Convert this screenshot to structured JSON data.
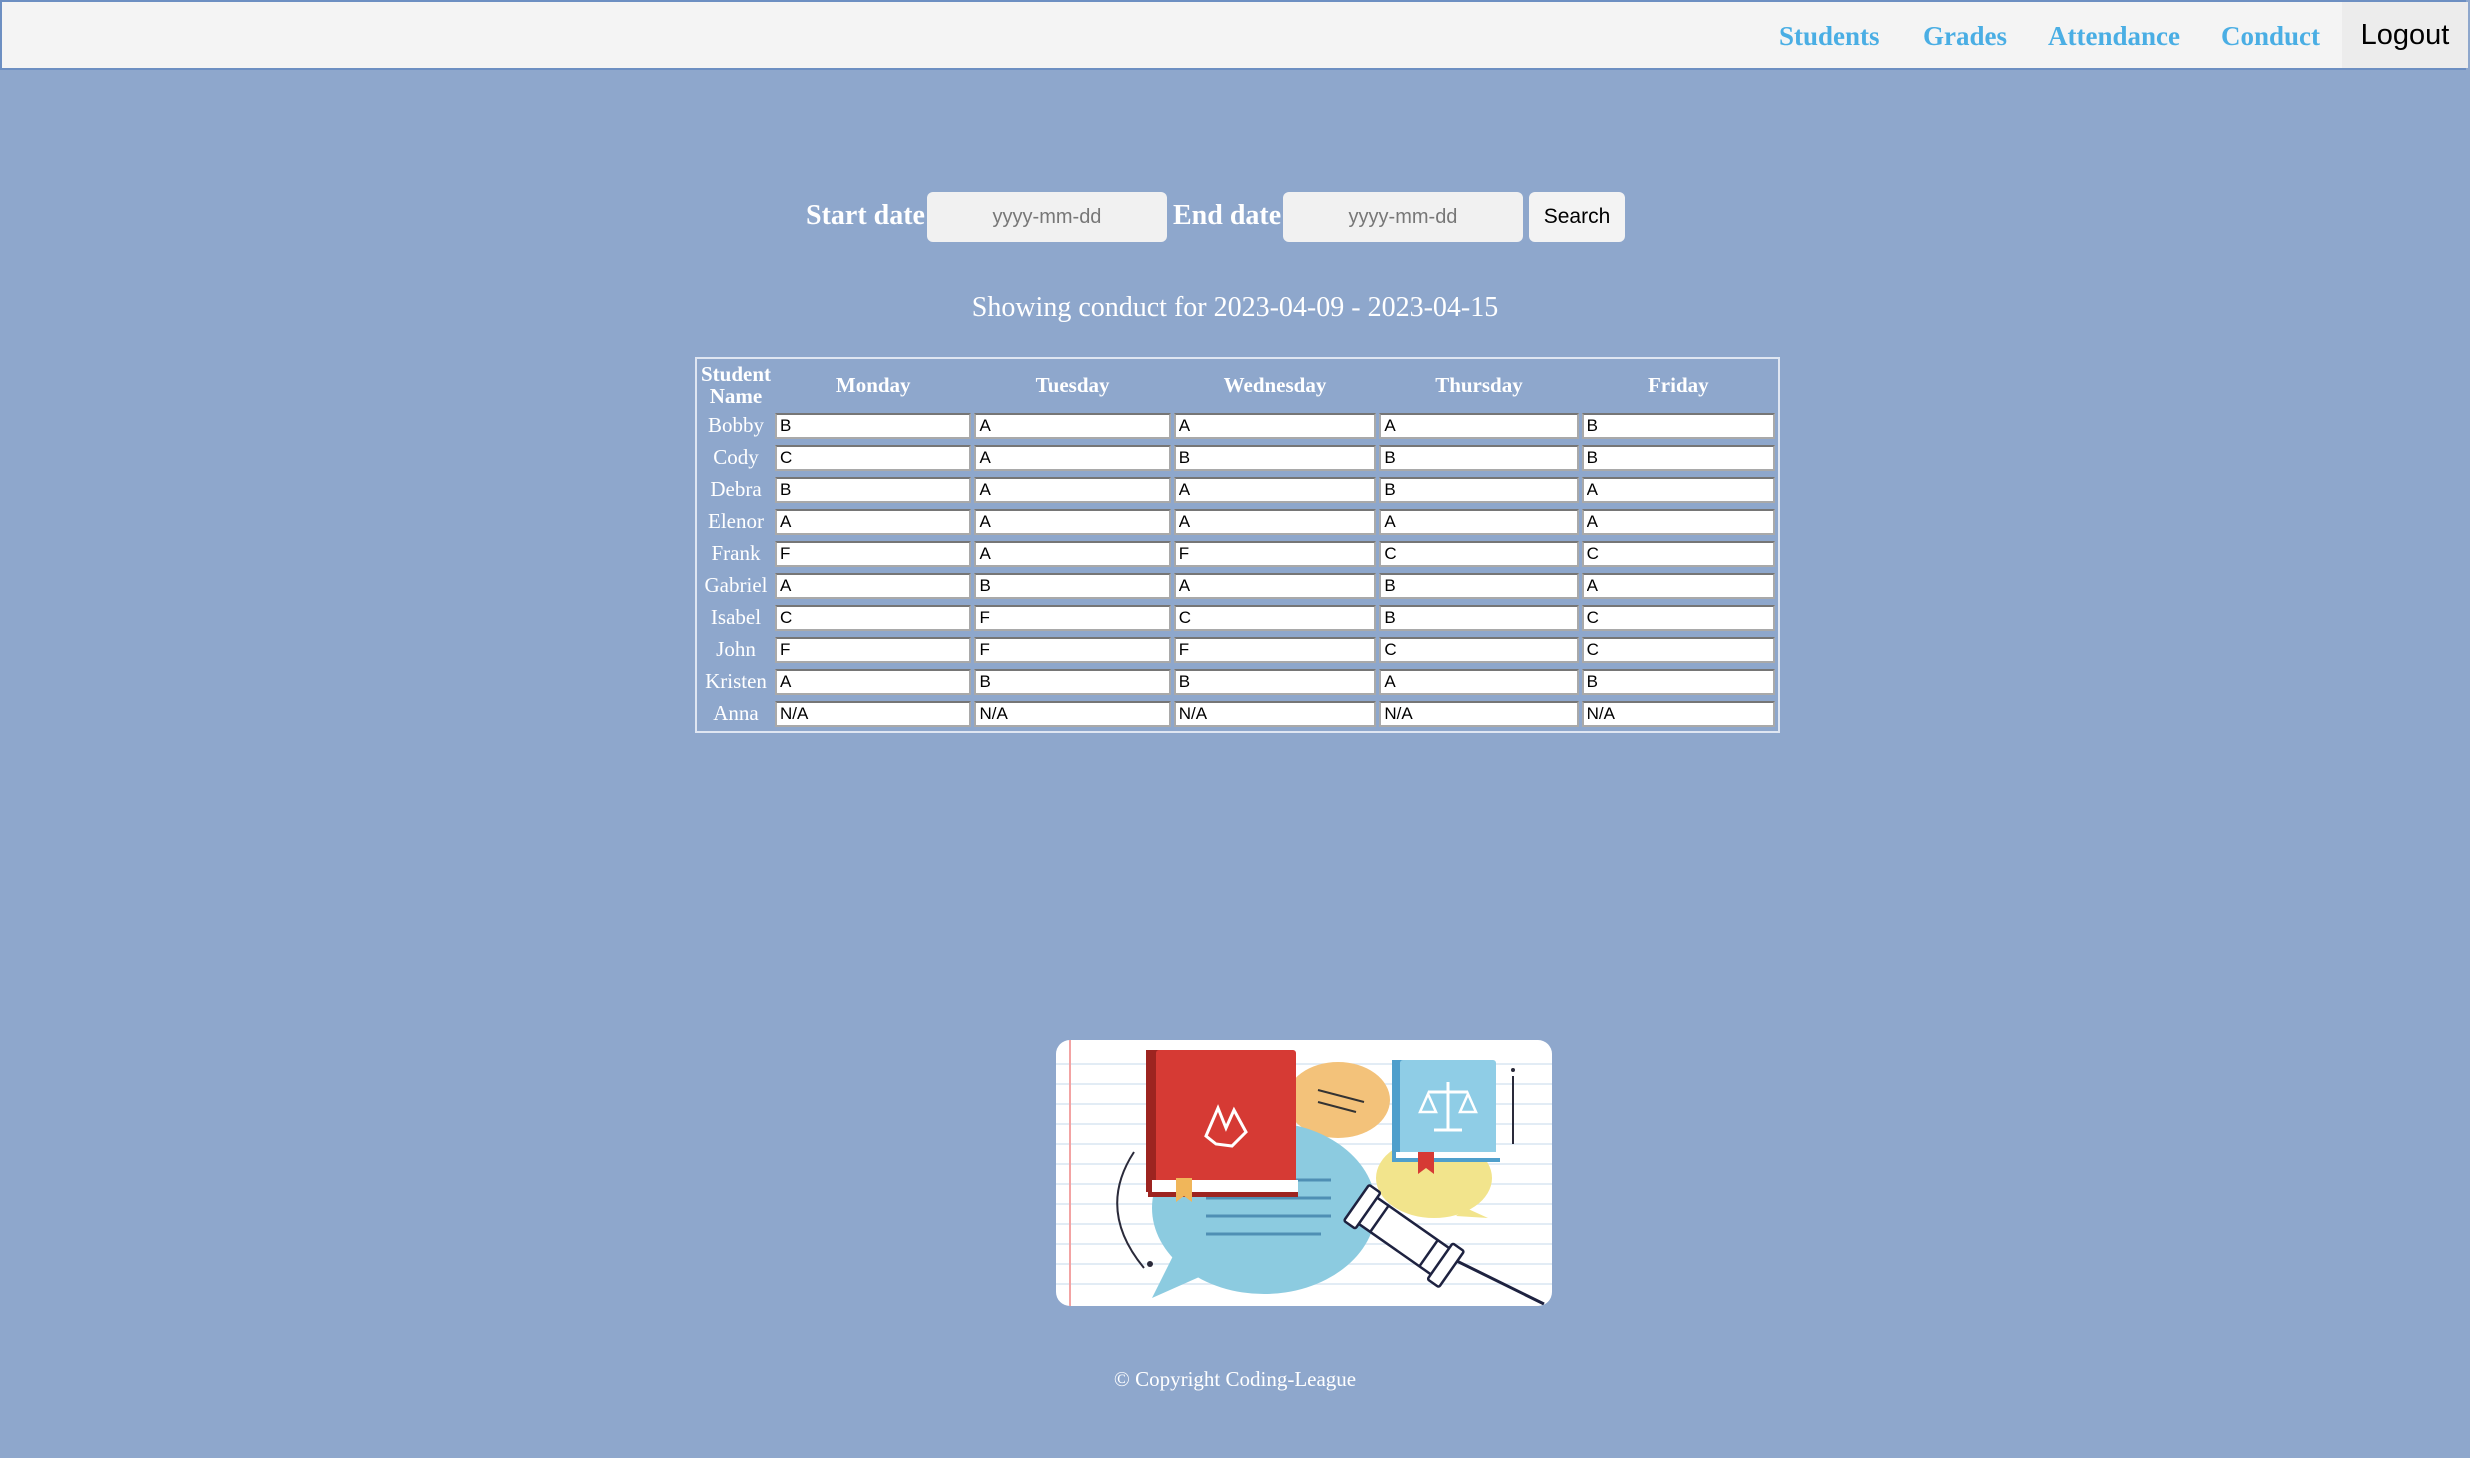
{
  "nav": {
    "students": "Students",
    "grades": "Grades",
    "attendance": "Attendance",
    "conduct": "Conduct",
    "logout": "Logout"
  },
  "search": {
    "start_label": "Start date",
    "end_label": "End date",
    "start_placeholder": "yyyy-mm-dd",
    "end_placeholder": "yyyy-mm-dd",
    "button_label": "Search"
  },
  "showing_text": "Showing conduct for 2023-04-09 - 2023-04-15",
  "table": {
    "headers": [
      "Student Name",
      "Monday",
      "Tuesday",
      "Wednesday",
      "Thursday",
      "Friday"
    ],
    "rows": [
      {
        "name": "Bobby",
        "grades": [
          "B",
          "A",
          "A",
          "A",
          "B"
        ]
      },
      {
        "name": "Cody",
        "grades": [
          "C",
          "A",
          "B",
          "B",
          "B"
        ]
      },
      {
        "name": "Debra",
        "grades": [
          "B",
          "A",
          "A",
          "B",
          "A"
        ]
      },
      {
        "name": "Elenor",
        "grades": [
          "A",
          "A",
          "A",
          "A",
          "A"
        ]
      },
      {
        "name": "Frank",
        "grades": [
          "F",
          "A",
          "F",
          "C",
          "C"
        ]
      },
      {
        "name": "Gabriel",
        "grades": [
          "A",
          "B",
          "A",
          "B",
          "A"
        ]
      },
      {
        "name": "Isabel",
        "grades": [
          "C",
          "F",
          "C",
          "B",
          "C"
        ]
      },
      {
        "name": "John",
        "grades": [
          "F",
          "F",
          "F",
          "C",
          "C"
        ]
      },
      {
        "name": "Kristen",
        "grades": [
          "A",
          "B",
          "B",
          "A",
          "B"
        ]
      },
      {
        "name": "Anna",
        "grades": [
          "N/A",
          "N/A",
          "N/A",
          "N/A",
          "N/A"
        ]
      }
    ]
  },
  "footer": "© Copyright Coding-League",
  "colors": {
    "background": "#8ea7cc",
    "nav_link": "#4aaee4",
    "book_red": "#d63a34",
    "bubble_blue": "#8ccbe0",
    "bubble_orange": "#f3c27a",
    "bubble_yellow": "#f2e48c",
    "book_blue": "#8fcde6"
  },
  "illustration_icons": [
    "book-icon",
    "speech-bubble-icon",
    "scales-of-justice-icon",
    "gavel-icon"
  ]
}
